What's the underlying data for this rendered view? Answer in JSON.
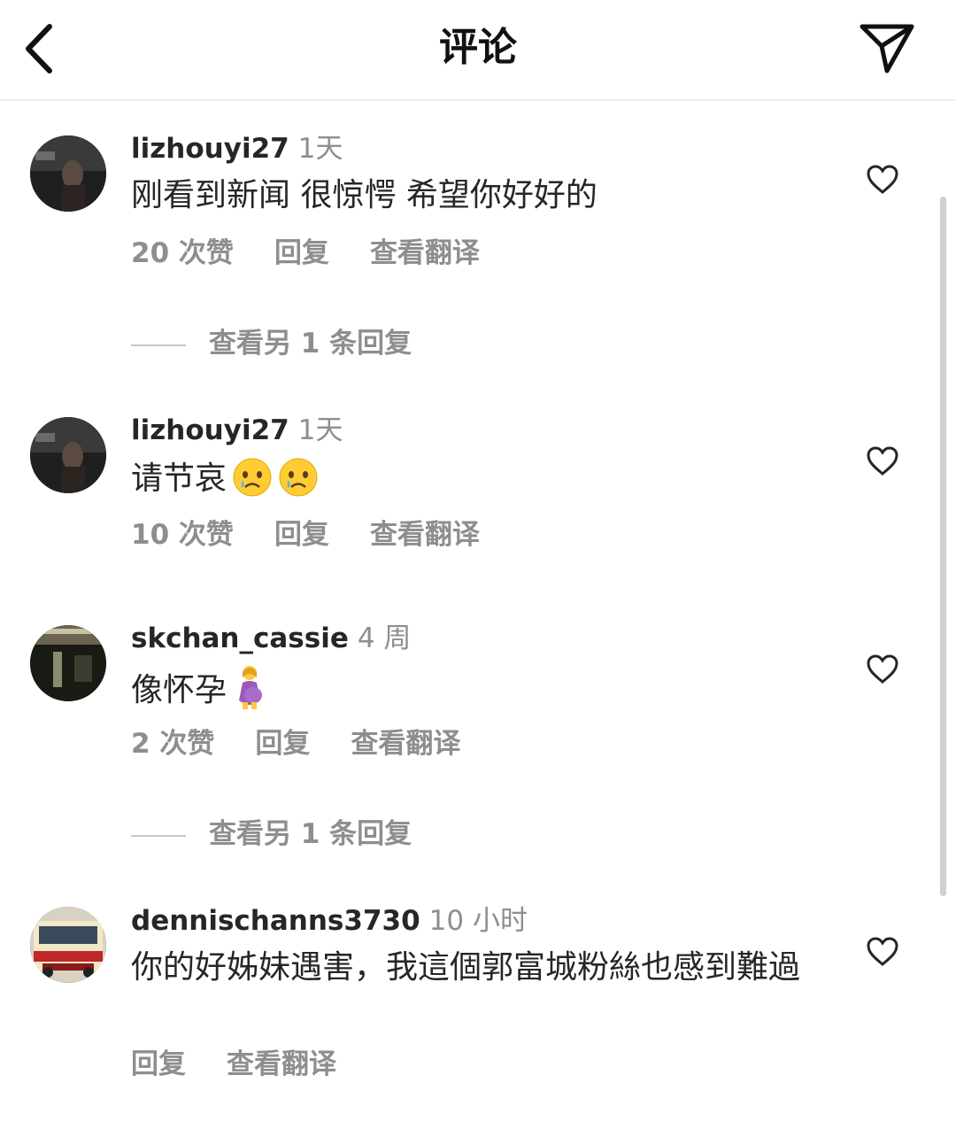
{
  "header": {
    "title": "评论",
    "back_icon": "chevron-left-icon",
    "send_icon": "paper-plane-icon"
  },
  "comments": [
    {
      "username": "lizhouyi27",
      "time": "1天",
      "text": "刚看到新闻 很惊愕 希望你好好的",
      "likes": "20 次赞",
      "reply": "回复",
      "translate": "查看翻译",
      "view_replies": "查看另 1 条回复"
    },
    {
      "username": "lizhouyi27",
      "time": "1天",
      "text": "请节哀",
      "emojis": [
        "crying-face-emoji",
        "crying-face-emoji"
      ],
      "likes": "10 次赞",
      "reply": "回复",
      "translate": "查看翻译"
    },
    {
      "username": "skchan_cassie",
      "time": "4 周",
      "text": "像怀孕",
      "emojis": [
        "pregnant-woman-emoji"
      ],
      "likes": "2 次赞",
      "reply": "回复",
      "translate": "查看翻译",
      "view_replies": "查看另 1 条回复"
    },
    {
      "username": "dennischanns3730",
      "time": "10 小时",
      "text": "你的好姊妹遇害，我這個郭富城粉絲也感到難過",
      "reply": "回复",
      "translate": "查看翻译"
    }
  ],
  "colors": {
    "primary_text": "#262626",
    "secondary_text": "#8e8e8e",
    "divider": "#ececec"
  }
}
